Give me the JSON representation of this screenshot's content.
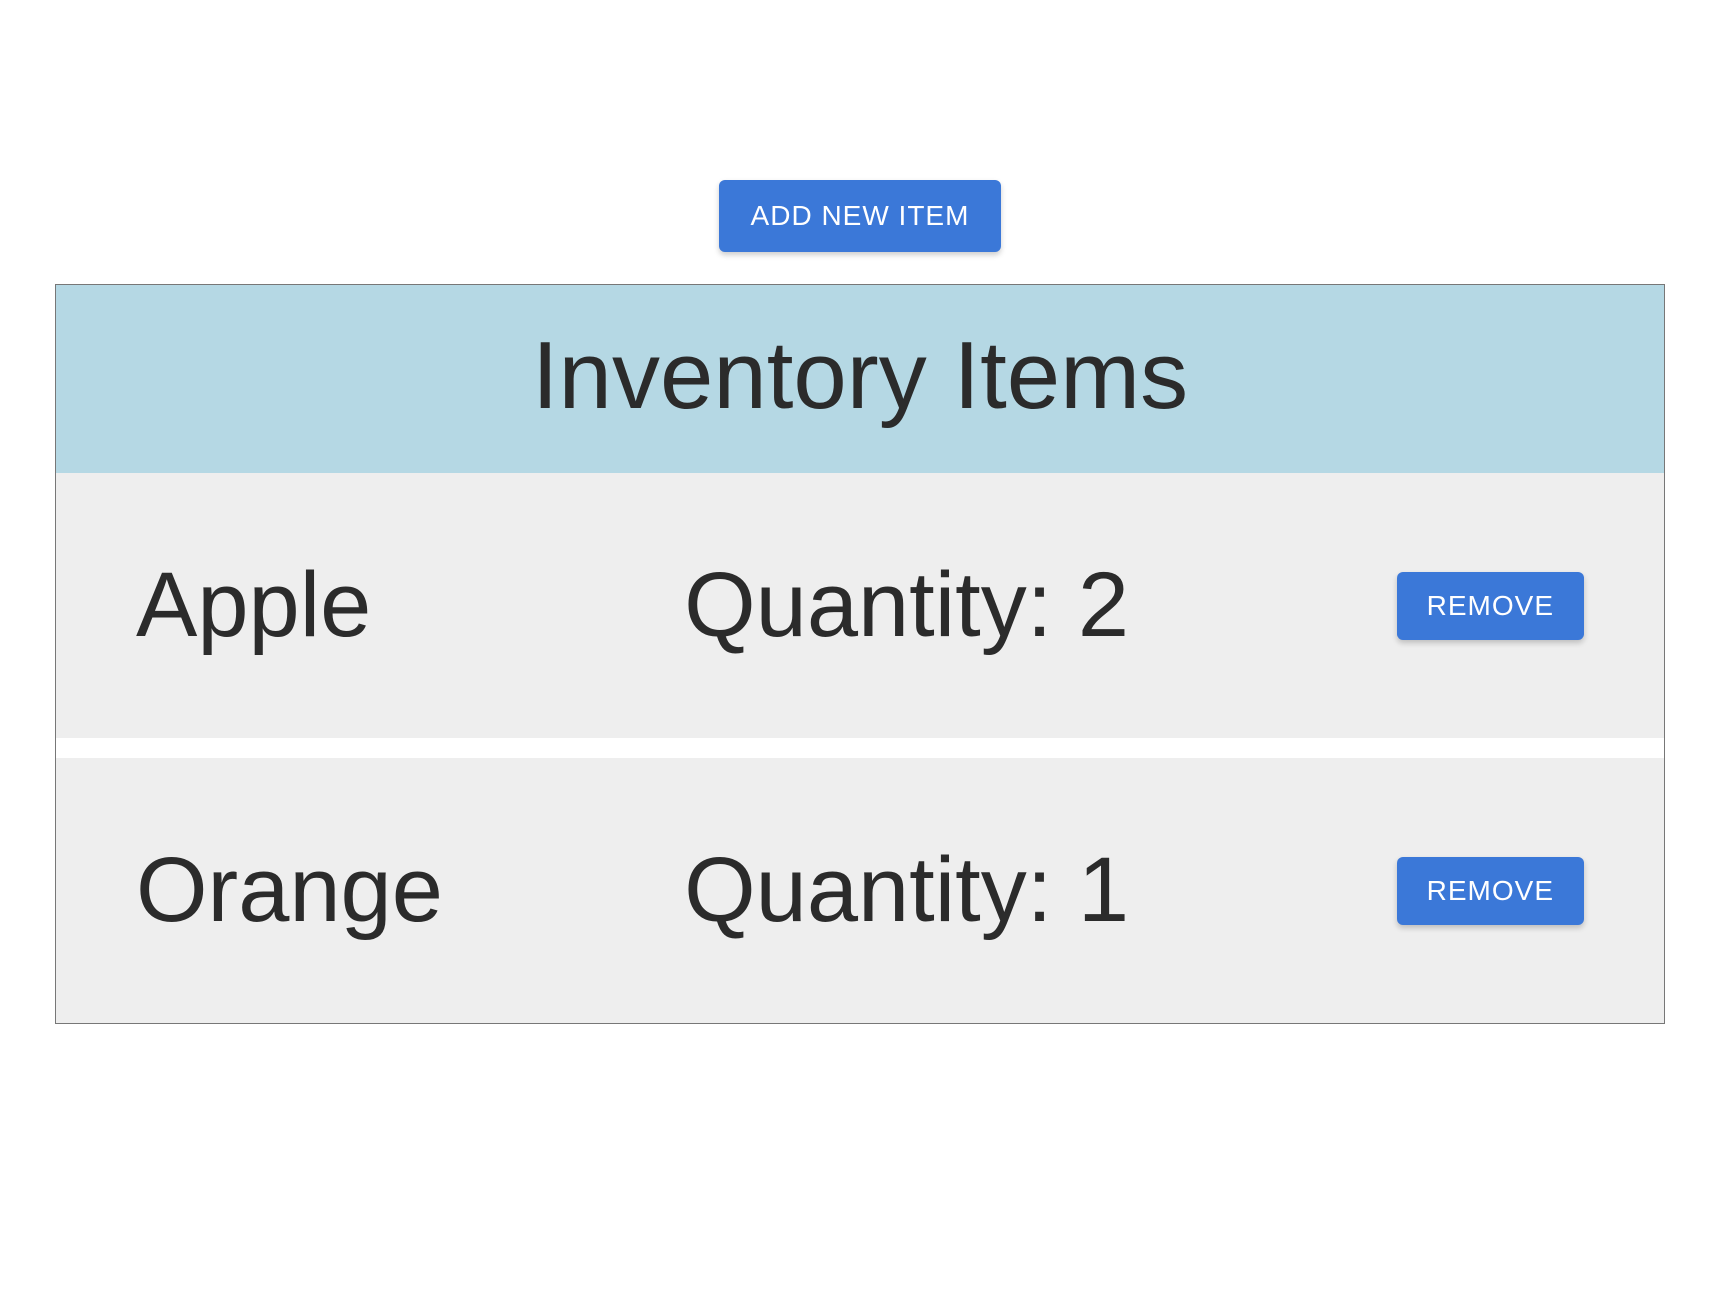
{
  "buttons": {
    "add": "ADD NEW ITEM",
    "remove": "REMOVE"
  },
  "panel": {
    "title": "Inventory Items"
  },
  "quantity_prefix": "Quantity: ",
  "items": [
    {
      "name": "Apple",
      "quantity": 2
    },
    {
      "name": "Orange",
      "quantity": 1
    }
  ]
}
